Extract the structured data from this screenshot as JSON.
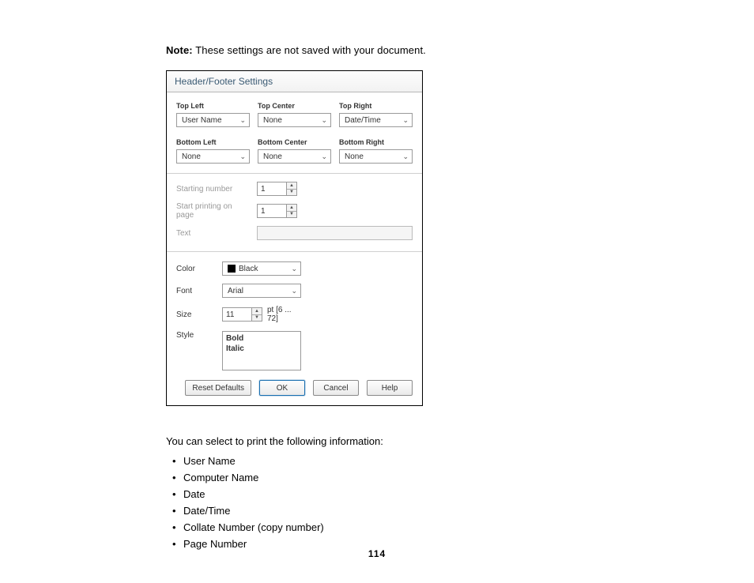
{
  "note": {
    "label": "Note:",
    "text": " These settings are not saved with your document."
  },
  "dialog": {
    "title": "Header/Footer Settings",
    "positions": {
      "top_left": {
        "label": "Top Left",
        "value": "User Name"
      },
      "top_center": {
        "label": "Top Center",
        "value": "None"
      },
      "top_right": {
        "label": "Top Right",
        "value": "Date/Time"
      },
      "bottom_left": {
        "label": "Bottom Left",
        "value": "None"
      },
      "bottom_center": {
        "label": "Bottom Center",
        "value": "None"
      },
      "bottom_right": {
        "label": "Bottom Right",
        "value": "None"
      }
    },
    "starting_number": {
      "label": "Starting number",
      "value": "1"
    },
    "start_page": {
      "label": "Start printing on page",
      "value": "1"
    },
    "text_row": {
      "label": "Text"
    },
    "color": {
      "label": "Color",
      "value": "Black"
    },
    "font": {
      "label": "Font",
      "value": "Arial"
    },
    "size": {
      "label": "Size",
      "value": "11",
      "hint": "pt  [6 ... 72]"
    },
    "style": {
      "label": "Style",
      "options": [
        "Bold",
        "Italic"
      ]
    },
    "buttons": {
      "reset": "Reset Defaults",
      "ok": "OK",
      "cancel": "Cancel",
      "help": "Help"
    }
  },
  "prose": {
    "lead": "You can select to print the following information:",
    "items": [
      "User Name",
      "Computer Name",
      "Date",
      "Date/Time",
      "Collate Number (copy number)",
      "Page Number"
    ]
  },
  "page_number": "114"
}
